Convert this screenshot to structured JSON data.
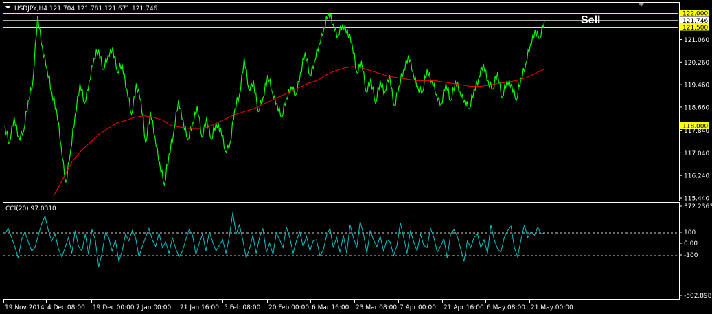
{
  "colors": {
    "background": "#000000",
    "frame": "#ffffff",
    "price": "#00ff00",
    "ma": "#ff0000",
    "hline": "#ffff00",
    "cci": "#00c8c8",
    "level_label_bg": "#ffff00",
    "level_label_text": "#000000",
    "current_label_bg": "#ffffff"
  },
  "header": {
    "menu_icon": "triangle-down-icon",
    "title": "USDJPY,H4  121.704 121.781 121.671 121.746"
  },
  "annotation": {
    "sell_label": "Sell"
  },
  "chart_data": [
    {
      "type": "line",
      "title": "USDJPY,H4  121.704 121.781 121.671 121.746",
      "series": [
        {
          "values": [
            118.0,
            117.4,
            118.3,
            117.6,
            117.8,
            118.9,
            119.6,
            121.9,
            120.8,
            120.0,
            119.2,
            118.6,
            117.3,
            116.0,
            117.1,
            118.4,
            119.5,
            118.8,
            119.6,
            120.4,
            120.7,
            120.0,
            120.5,
            120.8,
            119.9,
            120.2,
            119.3,
            118.4,
            119.5,
            118.9,
            117.4,
            118.5,
            117.6,
            116.7,
            115.9,
            117.0,
            117.8,
            118.9,
            118.2,
            117.5,
            118.1,
            118.7,
            117.6,
            118.3,
            117.5,
            118.1,
            117.9,
            117.1,
            117.4,
            118.6,
            119.1,
            120.4,
            119.3,
            119.6,
            118.5,
            119.0,
            119.8,
            119.2,
            118.8,
            118.3,
            119.0,
            119.4,
            119.1,
            119.9,
            120.6,
            119.8,
            120.3,
            120.9,
            121.5,
            122.0,
            121.6,
            121.2,
            121.6,
            121.4,
            120.9,
            119.9,
            120.3,
            119.2,
            119.7,
            118.8,
            119.6,
            119.2,
            119.8,
            118.7,
            119.4,
            120.0,
            120.5,
            119.9,
            119.4,
            119.2,
            120.0,
            119.6,
            119.1,
            118.8,
            119.5,
            118.9,
            119.6,
            119.2,
            118.9,
            118.6,
            119.3,
            119.7,
            120.2,
            119.6,
            119.3,
            119.9,
            119.0,
            119.6,
            119.5,
            118.9,
            119.7,
            120.2,
            120.9,
            121.4,
            121.1,
            121.75
          ]
        },
        {
          "values": [
            115.5,
            116.1,
            116.7,
            117.1,
            117.4,
            117.7,
            117.9,
            118.1,
            118.2,
            118.3,
            118.35,
            118.3,
            118.2,
            118.0,
            117.95,
            117.9,
            117.9,
            117.95,
            118.1,
            118.25,
            118.4,
            118.5,
            118.6,
            118.75,
            118.9,
            119.05,
            119.2,
            119.35,
            119.5,
            119.6,
            119.8,
            119.95,
            120.05,
            120.1,
            120.05,
            119.95,
            119.85,
            119.75,
            119.7,
            119.65,
            119.6,
            119.6,
            119.6,
            119.55,
            119.5,
            119.45,
            119.4,
            119.4,
            119.45,
            119.5,
            119.55,
            119.6,
            119.7,
            119.85,
            120.0
          ]
        }
      ],
      "y_ticks": [
        "122.000",
        "121.746",
        "121.500",
        "121.060",
        "120.260",
        "119.460",
        "118.660",
        "118.000",
        "117.840",
        "117.040",
        "116.240",
        "115.440"
      ],
      "ylim": [
        115.44,
        122.4
      ],
      "hlines": [
        {
          "value": 122.0,
          "label": "122.000",
          "style": "label"
        },
        {
          "value": 121.746,
          "label": "121.746",
          "style": "current"
        },
        {
          "value": 121.5,
          "label": "121.500",
          "style": "label"
        },
        {
          "value": 118.0,
          "label": "118.000",
          "style": "label"
        }
      ],
      "x_ticks": [
        "19 Nov 2014",
        "4 Dec 08:00",
        "19 Dec 00:00",
        "7 Jan 00:00",
        "21 Jan 16:00",
        "5 Feb 08:00",
        "20 Feb 00:00",
        "6 Mar 16:00",
        "23 Mar 08:00",
        "7 Apr 00:00",
        "21 Apr 16:00",
        "6 May 08:00",
        "21 May 00:00"
      ],
      "grid": false
    },
    {
      "type": "line",
      "title": "CCI(20) 97.0310",
      "series": [
        {
          "values": [
            90,
            140,
            60,
            -20,
            -120,
            40,
            110,
            20,
            -60,
            -30,
            80,
            180,
            250,
            120,
            30,
            90,
            -40,
            -110,
            -30,
            60,
            -80,
            120,
            -20,
            -60,
            90,
            -90,
            130,
            40,
            -200,
            -80,
            100,
            60,
            -60,
            40,
            -150,
            -60,
            90,
            30,
            120,
            60,
            -110,
            -20,
            60,
            140,
            40,
            -20,
            100,
            -30,
            20,
            -80,
            60,
            -40,
            -110,
            -60,
            40,
            130,
            80,
            -90,
            10,
            90,
            -60,
            110,
            20,
            -60,
            -10,
            40,
            -80,
            70,
            280,
            90,
            170,
            40,
            -120,
            -40,
            80,
            -80,
            60,
            140,
            -70,
            10,
            -90,
            100,
            40,
            -30,
            150,
            60,
            -80,
            30,
            110,
            -20,
            70,
            -60,
            30,
            40,
            -100,
            -50,
            80,
            140,
            -30,
            60,
            -70,
            80,
            -80,
            170,
            60,
            -30,
            200,
            90,
            -80,
            120,
            40,
            -20,
            70,
            -60,
            40,
            20,
            -100,
            -10,
            190,
            60,
            -80,
            120,
            20,
            -60,
            90,
            -10,
            -30,
            140,
            60,
            -70,
            -20,
            50,
            -120,
            90,
            130,
            70,
            -40,
            -150,
            30,
            -30,
            60,
            90,
            -30,
            40,
            -80,
            170,
            40,
            -40,
            -70,
            60,
            120,
            160,
            -30,
            -110,
            40,
            170,
            60,
            110,
            80,
            150,
            90,
            100
          ]
        }
      ],
      "y_ticks": [
        "372.2363",
        "100",
        "0.00",
        "-100",
        "-502.8983"
      ],
      "ylim": [
        -502.8983,
        372.2363
      ],
      "levels": [
        100,
        -100
      ],
      "grid": false
    }
  ]
}
